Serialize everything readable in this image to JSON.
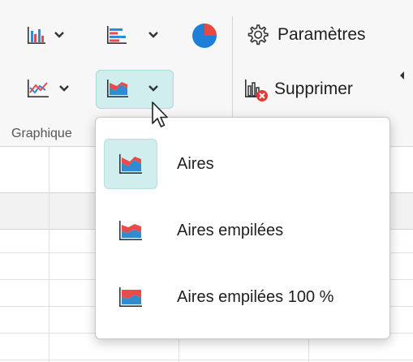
{
  "ribbon": {
    "settings_label": "Paramètres",
    "delete_label": "Supprimer",
    "group_label": "Graphique"
  },
  "area_menu": {
    "items": [
      {
        "label": "Aires",
        "icon": "area-chart-icon",
        "selected": true
      },
      {
        "label": "Aires empilées",
        "icon": "stacked-area-chart-icon",
        "selected": false
      },
      {
        "label": "Aires empilées 100 %",
        "icon": "stacked-area-100-chart-icon",
        "selected": false
      }
    ]
  },
  "colors": {
    "accent_teal": "#cfeeed",
    "chart_blue": "#2f8cd0",
    "chart_red": "#e84b4b",
    "pie_blue": "#1f7ed8",
    "pie_red": "#e8483e"
  }
}
